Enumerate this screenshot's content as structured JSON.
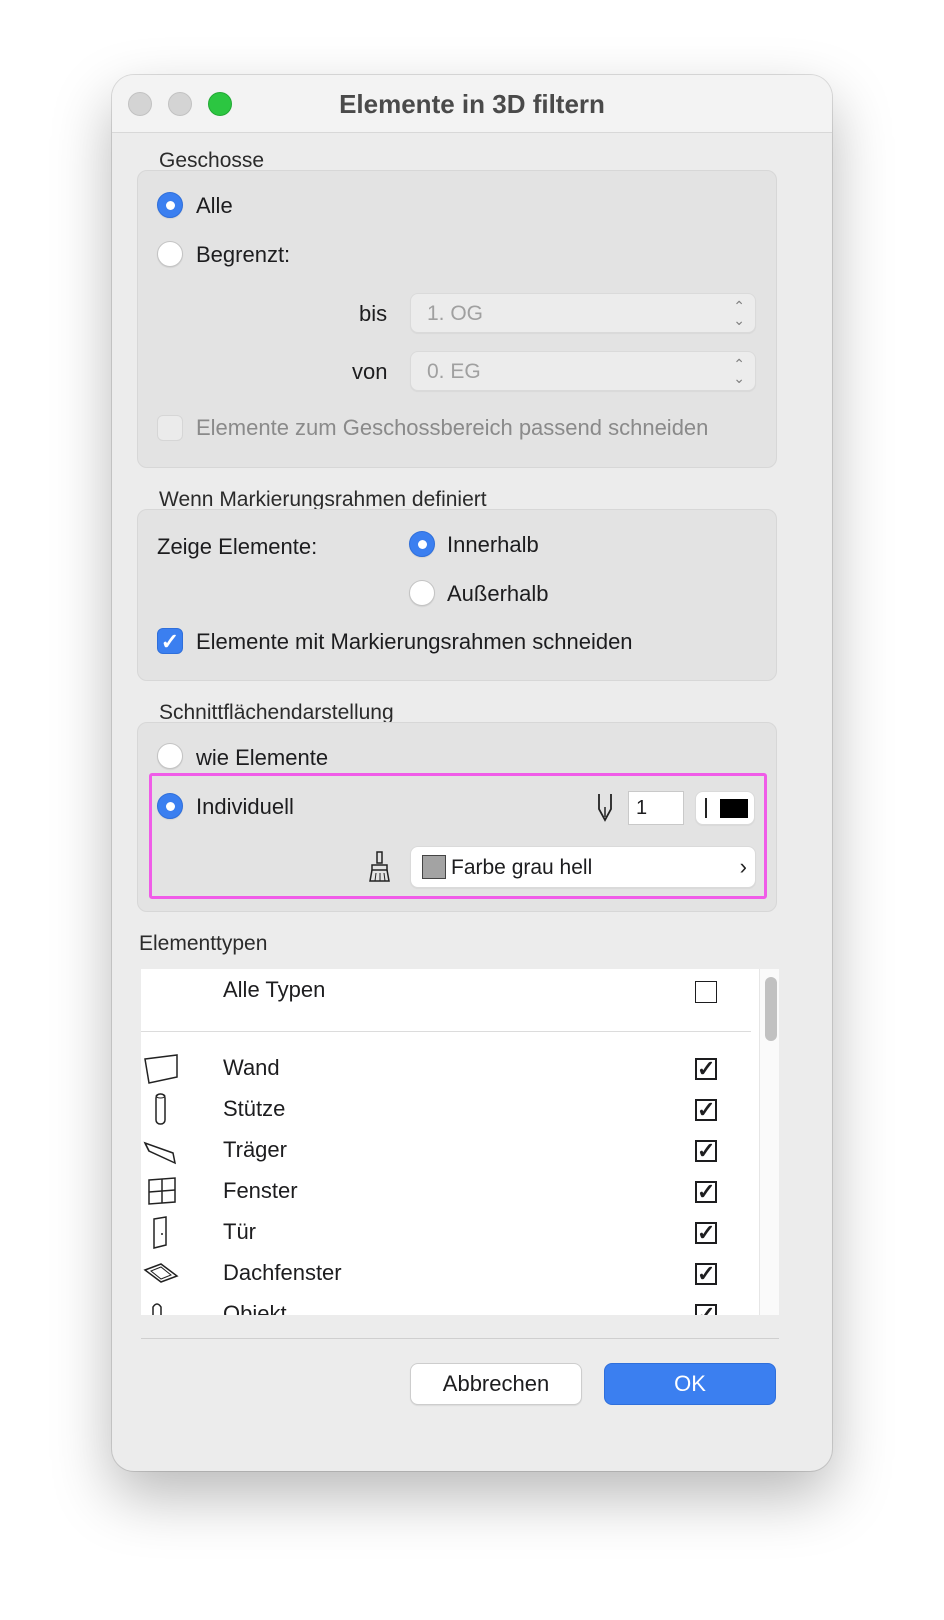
{
  "window": {
    "title": "Elemente in 3D filtern"
  },
  "geschosse": {
    "section_label": "Geschosse",
    "radio_alle": "Alle",
    "radio_begrenzt": "Begrenzt:",
    "bis_label": "bis",
    "bis_value": "1. OG",
    "von_label": "von",
    "von_value": "0. EG",
    "cut_checkbox": "Elemente zum Geschossbereich passend schneiden"
  },
  "markierung": {
    "section_label": "Wenn Markierungsrahmen definiert",
    "zeige_label": "Zeige Elemente:",
    "radio_innerhalb": "Innerhalb",
    "radio_ausserhalb": "Außerhalb",
    "cut_checkbox": "Elemente mit  Markierungsrahmen schneiden"
  },
  "schnitt": {
    "section_label": "Schnittflächendarstellung",
    "radio_wie": "wie Elemente",
    "radio_individuell": "Individuell",
    "pen_value": "1",
    "fill_label": "Farbe grau hell",
    "fill_swatch_color": "#a3a3a3",
    "highlight_color": "#f05ce8"
  },
  "elementtypen": {
    "section_label": "Elementtypen",
    "all_types": "Alle Typen",
    "items": [
      {
        "name": "Wand",
        "icon": "wall-icon"
      },
      {
        "name": "Stütze",
        "icon": "column-icon"
      },
      {
        "name": "Träger",
        "icon": "beam-icon"
      },
      {
        "name": "Fenster",
        "icon": "window-icon"
      },
      {
        "name": "Tür",
        "icon": "door-icon"
      },
      {
        "name": "Dachfenster",
        "icon": "skylight-icon"
      },
      {
        "name": "Objekt",
        "icon": "object-icon"
      }
    ]
  },
  "buttons": {
    "cancel": "Abbrechen",
    "ok": "OK"
  },
  "colors": {
    "accent": "#3b7ff0"
  }
}
